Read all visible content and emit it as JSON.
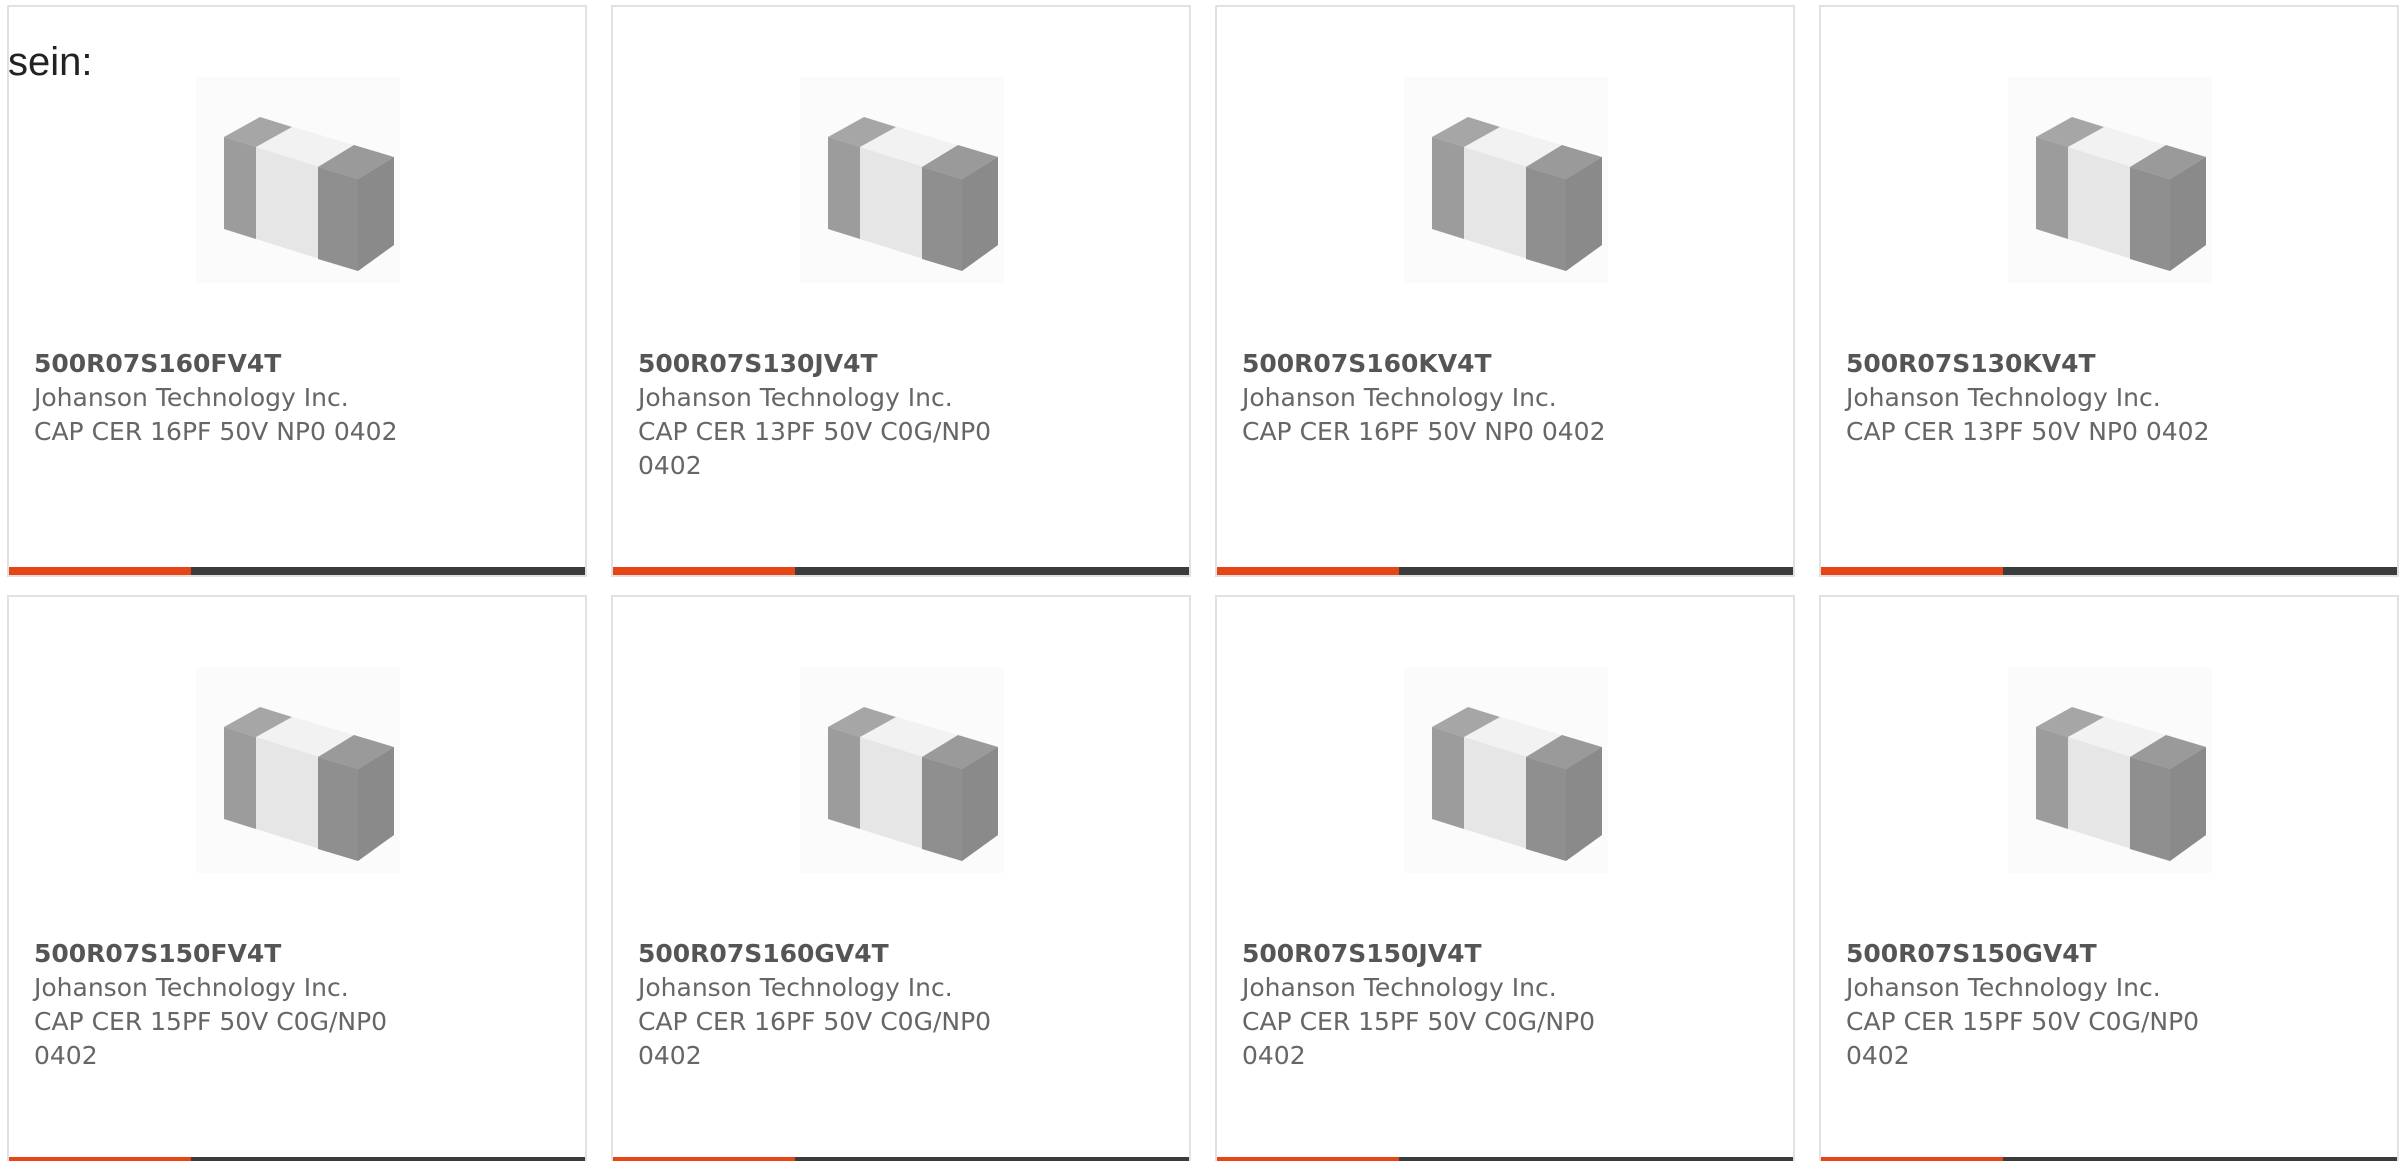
{
  "intro_text": "sein:",
  "accent_color": "#e84516",
  "bar_color": "#3c3c3c",
  "products": [
    {
      "part_number": "500R07S160FV4T",
      "manufacturer": "Johanson Technology Inc.",
      "description": "CAP CER 16PF 50V NP0 0402",
      "image": "ceramic-capacitor-chip-image"
    },
    {
      "part_number": "500R07S130JV4T",
      "manufacturer": "Johanson Technology Inc.",
      "description": "CAP CER 13PF 50V C0G/NP0 0402",
      "image": "ceramic-capacitor-chip-image"
    },
    {
      "part_number": "500R07S160KV4T",
      "manufacturer": "Johanson Technology Inc.",
      "description": "CAP CER 16PF 50V NP0 0402",
      "image": "ceramic-capacitor-chip-image"
    },
    {
      "part_number": "500R07S130KV4T",
      "manufacturer": "Johanson Technology Inc.",
      "description": "CAP CER 13PF 50V NP0 0402",
      "image": "ceramic-capacitor-chip-image"
    },
    {
      "part_number": "500R07S150FV4T",
      "manufacturer": "Johanson Technology Inc.",
      "description": "CAP CER 15PF 50V C0G/NP0 0402",
      "image": "ceramic-capacitor-chip-image"
    },
    {
      "part_number": "500R07S160GV4T",
      "manufacturer": "Johanson Technology Inc.",
      "description": "CAP CER 16PF 50V C0G/NP0 0402",
      "image": "ceramic-capacitor-chip-image"
    },
    {
      "part_number": "500R07S150JV4T",
      "manufacturer": "Johanson Technology Inc.",
      "description": "CAP CER 15PF 50V C0G/NP0 0402",
      "image": "ceramic-capacitor-chip-image"
    },
    {
      "part_number": "500R07S150GV4T",
      "manufacturer": "Johanson Technology Inc.",
      "description": "CAP CER 15PF 50V C0G/NP0 0402",
      "image": "ceramic-capacitor-chip-image"
    }
  ]
}
